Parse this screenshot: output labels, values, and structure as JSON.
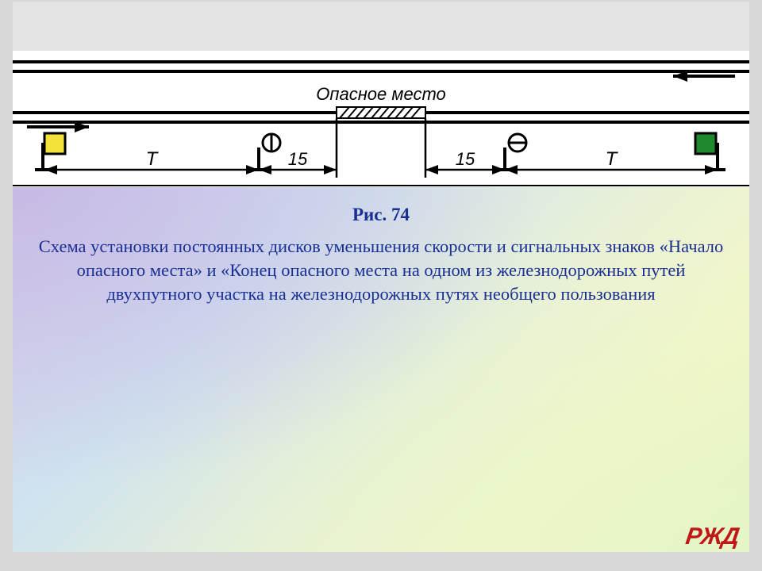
{
  "diagram": {
    "danger_label": "Опасное место",
    "dim_T_left": "T",
    "dim_15_left": "15",
    "dim_15_right": "15",
    "dim_T_right": "T"
  },
  "caption": {
    "title": "Рис. 74",
    "body": "Схема установки постоянных дисков уменьшения скорости и сигнальных знаков «Начало опасного места» и «Конец опасного места на одном из железнодорожных путей двухпутного участка на железнодорожных путях необщего пользования"
  },
  "logo": "PЖД"
}
